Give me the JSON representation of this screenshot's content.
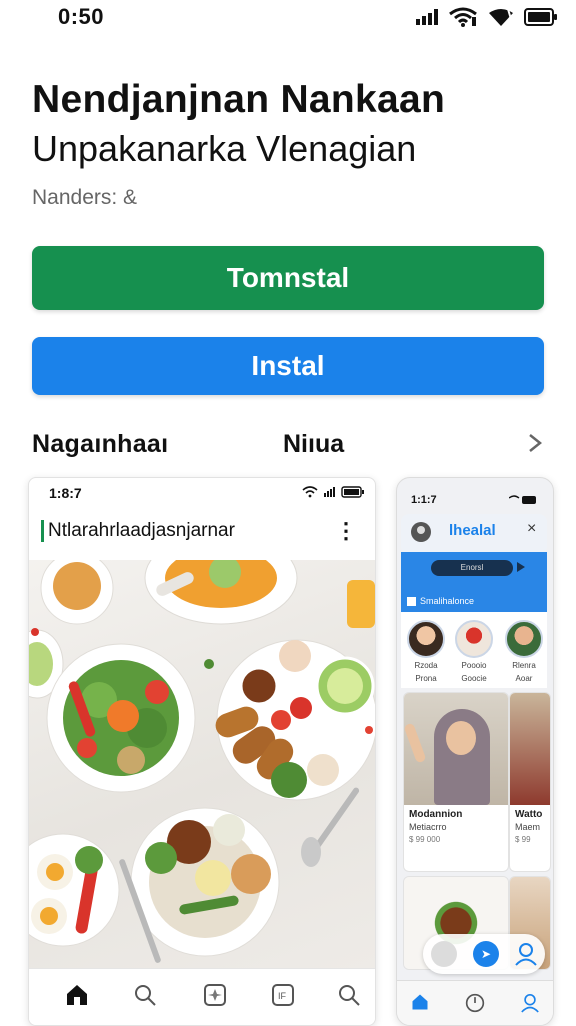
{
  "status_bar": {
    "time": "0:50"
  },
  "app": {
    "title": "Nendjanjnan Nankaan",
    "subtitle": "Unpakanarka Vlenagian",
    "meta": "Nanders: &"
  },
  "buttons": {
    "primary": "Tomnstal",
    "secondary": "Instal"
  },
  "section": {
    "left_label": "Nagaınhaaı",
    "right_label": "Niıua"
  },
  "screenshot1": {
    "time": "1:8:7",
    "title": "Ntlarahrlaadjasnjarnar"
  },
  "screenshot2": {
    "time": "1:1:7",
    "title": "lhealal",
    "pill": "Enorsl",
    "banner_label": "Smalihalonce",
    "people": [
      {
        "name1": "Rzoda",
        "name2": "Prona"
      },
      {
        "name1": "Poooio",
        "name2": "Goocie"
      },
      {
        "name1": "Rlenra",
        "name2": "Aoar"
      }
    ],
    "card1": {
      "title": "Modannion",
      "sub": "Metiacrro",
      "meta": "$ 99 000"
    },
    "card2": {
      "title": "Watto",
      "sub": "Maem",
      "meta": "$ 99"
    }
  },
  "colors": {
    "green": "#16904f",
    "blue": "#1b82ea"
  },
  "icons": [
    "signal-icon",
    "wifi-icon",
    "battery-icon",
    "chevron-right-icon",
    "more-icon",
    "home-icon",
    "search-icon",
    "apps-icon",
    "library-icon",
    "user-icon",
    "clock-icon"
  ]
}
